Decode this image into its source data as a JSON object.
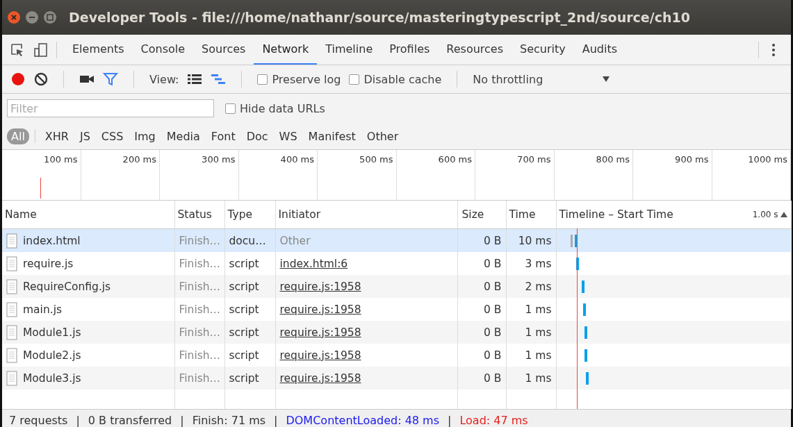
{
  "window": {
    "title": "Developer Tools - file:///home/nathanr/source/masteringtypescript_2nd/source/ch10"
  },
  "tabs": [
    {
      "label": "Elements",
      "selected": false
    },
    {
      "label": "Console",
      "selected": false
    },
    {
      "label": "Sources",
      "selected": false
    },
    {
      "label": "Network",
      "selected": true
    },
    {
      "label": "Timeline",
      "selected": false
    },
    {
      "label": "Profiles",
      "selected": false
    },
    {
      "label": "Resources",
      "selected": false
    },
    {
      "label": "Security",
      "selected": false
    },
    {
      "label": "Audits",
      "selected": false
    }
  ],
  "toolbar": {
    "recording": true,
    "view_label": "View:",
    "checkboxes": [
      {
        "label": "Preserve log",
        "checked": false
      },
      {
        "label": "Disable cache",
        "checked": false
      }
    ],
    "throttling": "No throttling"
  },
  "filter": {
    "placeholder": "Filter",
    "hide_data_urls": {
      "label": "Hide data URLs",
      "checked": false
    }
  },
  "type_filters": [
    {
      "label": "All",
      "selected": true
    },
    {
      "label": "XHR",
      "selected": false
    },
    {
      "label": "JS",
      "selected": false
    },
    {
      "label": "CSS",
      "selected": false
    },
    {
      "label": "Img",
      "selected": false
    },
    {
      "label": "Media",
      "selected": false
    },
    {
      "label": "Font",
      "selected": false
    },
    {
      "label": "Doc",
      "selected": false
    },
    {
      "label": "WS",
      "selected": false
    },
    {
      "label": "Manifest",
      "selected": false
    },
    {
      "label": "Other",
      "selected": false
    }
  ],
  "overview_ticks": [
    "100 ms",
    "200 ms",
    "300 ms",
    "400 ms",
    "500 ms",
    "600 ms",
    "700 ms",
    "800 ms",
    "900 ms",
    "1000 ms"
  ],
  "table": {
    "columns": [
      "Name",
      "Status",
      "Type",
      "Initiator",
      "Size",
      "Time",
      "Timeline – Start Time"
    ],
    "timeline_scale": "1.00 s",
    "rows": [
      {
        "name": "index.html",
        "status": "Finish…",
        "type": "docu…",
        "initiator": "Other",
        "initiator_link": false,
        "size": "0 B",
        "time": "10 ms",
        "selected": true
      },
      {
        "name": "require.js",
        "status": "Finish…",
        "type": "script",
        "initiator": "index.html:6",
        "initiator_link": true,
        "size": "0 B",
        "time": "3 ms",
        "selected": false
      },
      {
        "name": "RequireConfig.js",
        "status": "Finish…",
        "type": "script",
        "initiator": "require.js:1958",
        "initiator_link": true,
        "size": "0 B",
        "time": "2 ms",
        "selected": false
      },
      {
        "name": "main.js",
        "status": "Finish…",
        "type": "script",
        "initiator": "require.js:1958",
        "initiator_link": true,
        "size": "0 B",
        "time": "1 ms",
        "selected": false
      },
      {
        "name": "Module1.js",
        "status": "Finish…",
        "type": "script",
        "initiator": "require.js:1958",
        "initiator_link": true,
        "size": "0 B",
        "time": "1 ms",
        "selected": false
      },
      {
        "name": "Module2.js",
        "status": "Finish…",
        "type": "script",
        "initiator": "require.js:1958",
        "initiator_link": true,
        "size": "0 B",
        "time": "1 ms",
        "selected": false
      },
      {
        "name": "Module3.js",
        "status": "Finish…",
        "type": "script",
        "initiator": "require.js:1958",
        "initiator_link": true,
        "size": "0 B",
        "time": "1 ms",
        "selected": false
      }
    ]
  },
  "status_bar": [
    {
      "text": "7 requests",
      "kind": "plain"
    },
    {
      "text": "|",
      "kind": "separator"
    },
    {
      "text": "0 B transferred",
      "kind": "plain"
    },
    {
      "text": "|",
      "kind": "separator"
    },
    {
      "text": "Finish: 71 ms",
      "kind": "plain"
    },
    {
      "text": "|",
      "kind": "separator"
    },
    {
      "text": "DOMContentLoaded: 48 ms",
      "kind": "dom"
    },
    {
      "text": "|",
      "kind": "separator"
    },
    {
      "text": "Load: 47 ms",
      "kind": "load"
    }
  ]
}
